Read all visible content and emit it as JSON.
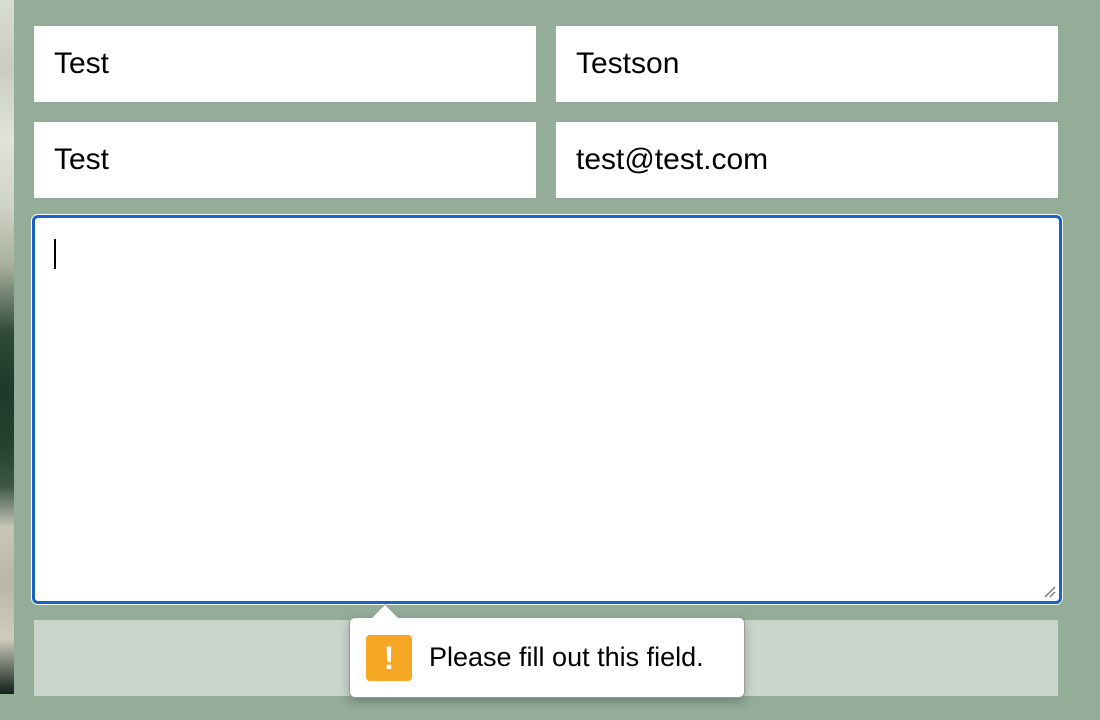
{
  "form": {
    "first_name": "Test",
    "last_name": "Testson",
    "company": "Test",
    "email": "test@test.com",
    "message": ""
  },
  "validation": {
    "message": "Please fill out this field.",
    "icon": "warning-icon",
    "icon_glyph": "!"
  },
  "colors": {
    "background": "#93ad99",
    "focus_ring": "#1a62c9",
    "warning": "#f5a623",
    "submit_bar": "#c8d4cc"
  }
}
